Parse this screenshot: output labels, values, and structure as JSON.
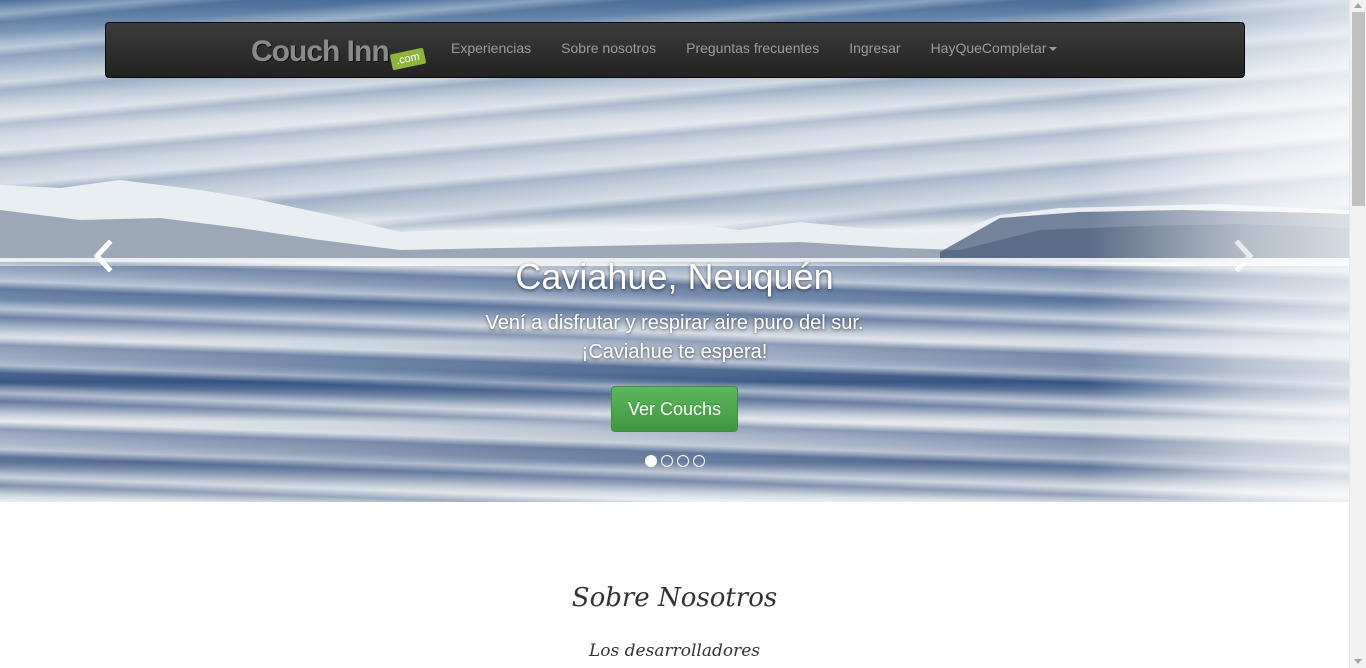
{
  "navbar": {
    "brand_text": "Couch Inn",
    "brand_suffix": ".com",
    "links": [
      {
        "label": "Experiencias"
      },
      {
        "label": "Sobre nosotros"
      },
      {
        "label": "Preguntas frecuentes"
      },
      {
        "label": "Ingresar"
      },
      {
        "label": "HayQueCompletar"
      }
    ]
  },
  "carousel": {
    "title": "Caviahue, Neuquén",
    "text_line1": "Vení a disfrutar y respirar aire puro del sur.",
    "text_line2": "¡Caviahue te espera!",
    "button_label": "Ver Couchs",
    "slides": 4,
    "active_slide": 1,
    "prev_icon": "chevron-left-icon",
    "next_icon": "chevron-right-icon"
  },
  "about": {
    "title": "Sobre Nosotros",
    "subtitle": "Los desarrolladores"
  },
  "colors": {
    "navbar_bg": "#222222",
    "nav_text": "#9d9d9d",
    "button_green": "#5cb85c",
    "brand_badge": "#8db53c"
  }
}
